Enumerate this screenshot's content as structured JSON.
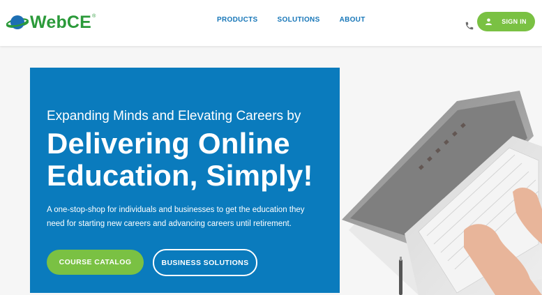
{
  "header": {
    "logo_text": "WebCE",
    "logo_reg": "®",
    "nav": [
      "PRODUCTS",
      "SOLUTIONS",
      "ABOUT"
    ],
    "phone_icon": "phone-icon",
    "signin_label": "SIGN IN",
    "signin_icon": "user-icon"
  },
  "hero": {
    "pretitle": "Expanding Minds and Elevating Careers by",
    "title": "Delivering Online Education, Simply!",
    "description": "A one-stop-shop for individuals and businesses to get the education they need for starting new careers and advancing careers until retirement.",
    "primary_button": "COURSE CATALOG",
    "secondary_button": "BUSINESS SOLUTIONS",
    "image": "laptop-typing-photo"
  },
  "colors": {
    "brand_green": "#7ac143",
    "logo_green": "#2b9a3a",
    "brand_blue": "#0a7bbd",
    "nav_blue": "#1776b8"
  }
}
